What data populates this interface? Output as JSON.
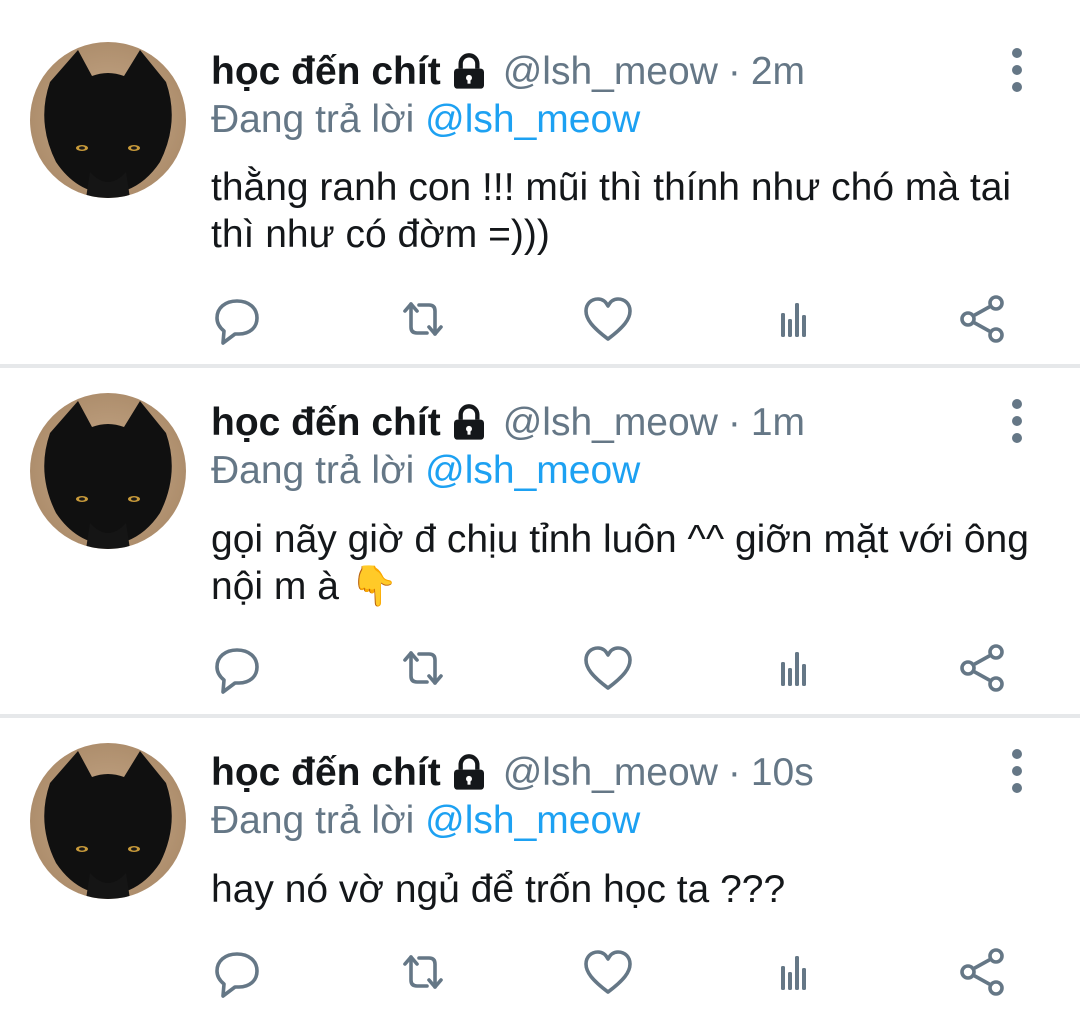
{
  "colors": {
    "accent": "#1da1f2",
    "secondary": "#657786",
    "text": "#14171a",
    "divider": "#e6e8ea"
  },
  "icons": {
    "lock": "lock-icon",
    "more": "more-vertical-icon",
    "reply": "reply-icon",
    "retweet": "retweet-icon",
    "like": "heart-icon",
    "analytics": "analytics-icon",
    "share": "share-icon"
  },
  "tweets": [
    {
      "name": "học đến chít",
      "handle": "@lsh_meow",
      "dot": "·",
      "time": "2m",
      "replying_prefix": "Đang trả lời",
      "replying_to": "@lsh_meow",
      "text": "thằng ranh con !!! mũi thì thính như chó mà tai thì như có đờm =)))"
    },
    {
      "name": "học đến chít",
      "handle": "@lsh_meow",
      "dot": "·",
      "time": "1m",
      "replying_prefix": "Đang trả lời",
      "replying_to": "@lsh_meow",
      "text": "gọi nãy giờ đ chịu tỉnh luôn ^^ giỡn mặt với ông nội m à 👇"
    },
    {
      "name": "học đến chít",
      "handle": "@lsh_meow",
      "dot": "·",
      "time": "10s",
      "replying_prefix": "Đang trả lời",
      "replying_to": "@lsh_meow",
      "text": "hay nó vờ ngủ để trốn học ta ???"
    }
  ]
}
